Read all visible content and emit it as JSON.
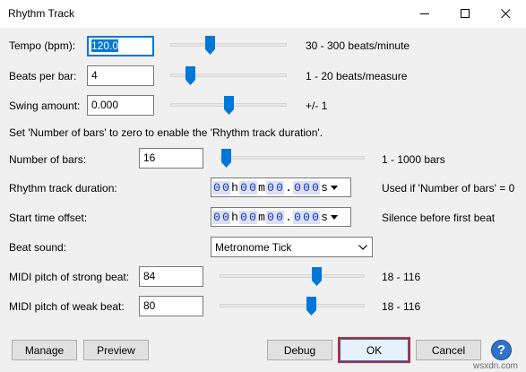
{
  "window": {
    "title": "Rhythm Track",
    "minimize_glyph": "—",
    "maximize_glyph": "☐",
    "close_glyph": "✕"
  },
  "rows": {
    "tempo": {
      "label": "Tempo (bpm):",
      "value": "120.0",
      "range": "30 - 300 beats/minute",
      "slider_level": 0.33
    },
    "beats_per_bar": {
      "label": "Beats per bar:",
      "value": "4",
      "range": "1 - 20 beats/measure",
      "slider_level": 0.16
    },
    "swing": {
      "label": "Swing amount:",
      "value": "0.000",
      "range": "+/- 1",
      "slider_level": 0.5
    },
    "info": "Set 'Number of bars' to zero to enable the 'Rhythm track duration'.",
    "number_of_bars": {
      "label": "Number of bars:",
      "value": "16",
      "range": "1 - 1000 bars",
      "slider_level": 0.02
    },
    "duration": {
      "label": "Rhythm track duration:",
      "time": [
        "0",
        "0",
        "h",
        "0",
        "0",
        "m",
        "0",
        "0",
        ".",
        "0",
        "0",
        "0",
        "s"
      ],
      "note": "Used if 'Number of bars' = 0"
    },
    "start_offset": {
      "label": "Start time offset:",
      "time": [
        "0",
        "0",
        "h",
        "0",
        "0",
        "m",
        "0",
        "0",
        ".",
        "0",
        "0",
        "0",
        "s"
      ],
      "note": "Silence before first beat"
    },
    "beat_sound": {
      "label": "Beat sound:",
      "value": "Metronome Tick"
    },
    "midi_strong": {
      "label": "MIDI pitch of strong beat:",
      "value": "84",
      "range": "18 - 116",
      "slider_level": 0.67
    },
    "midi_weak": {
      "label": "MIDI pitch of weak beat:",
      "value": "80",
      "range": "18 - 116",
      "slider_level": 0.63
    }
  },
  "buttons": {
    "manage": "Manage",
    "preview": "Preview",
    "debug": "Debug",
    "ok": "OK",
    "cancel": "Cancel",
    "help": "?"
  },
  "watermark": "wsxdn.com",
  "colors": {
    "accent": "#0078d7",
    "ok_highlight": "#d22027",
    "time_digits": "#0b35c8"
  }
}
